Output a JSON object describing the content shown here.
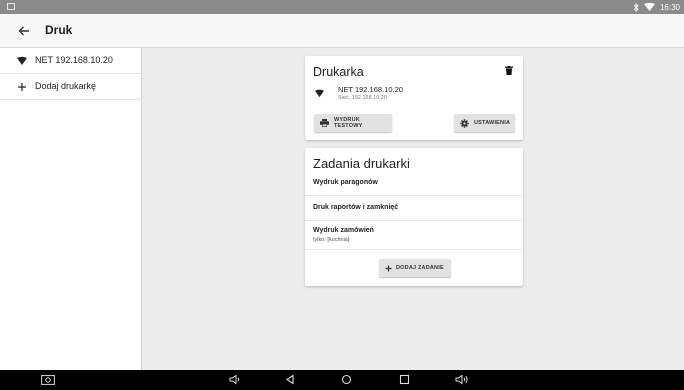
{
  "status_bar": {
    "time": "16:30",
    "icons": [
      "notification-icon",
      "bluetooth-icon",
      "wifi-icon"
    ]
  },
  "app_bar": {
    "title": "Druk",
    "back_icon": "arrow-left-icon"
  },
  "sidebar": {
    "items": [
      {
        "label": "NET 192.168.10.20",
        "icon": "wifi-icon"
      },
      {
        "label": "Dodaj drukarkę",
        "icon": "plus-icon"
      }
    ]
  },
  "printer_card": {
    "title": "Drukarka",
    "printer_name": "NET 192.168.10.20",
    "printer_sub": "Sieć, 192.168.10.20",
    "test_button": "WYDRUK TESTOWY",
    "settings_button": "USTAWIENIA"
  },
  "tasks_card": {
    "title": "Zadania drukarki",
    "tasks": [
      {
        "title": "Wydruk paragonów",
        "subtitle": ""
      },
      {
        "title": "Druk raportów i zamknięć",
        "subtitle": ""
      },
      {
        "title": "Wydruk zamówień",
        "subtitle": "tylko: [kuchnia]"
      }
    ],
    "add_button": "DODAJ ZADANIE"
  },
  "nav_bar": {
    "icons": [
      "screenshot-icon",
      "volume-down-icon",
      "back-icon",
      "home-icon",
      "recents-icon",
      "volume-up-icon"
    ]
  },
  "colors": {
    "status_bar": "#8a8a8a",
    "app_bar": "#f7f7f7",
    "background": "#ececec",
    "card": "#ffffff",
    "button": "#e2e2e2",
    "nav_bar": "#000000"
  }
}
